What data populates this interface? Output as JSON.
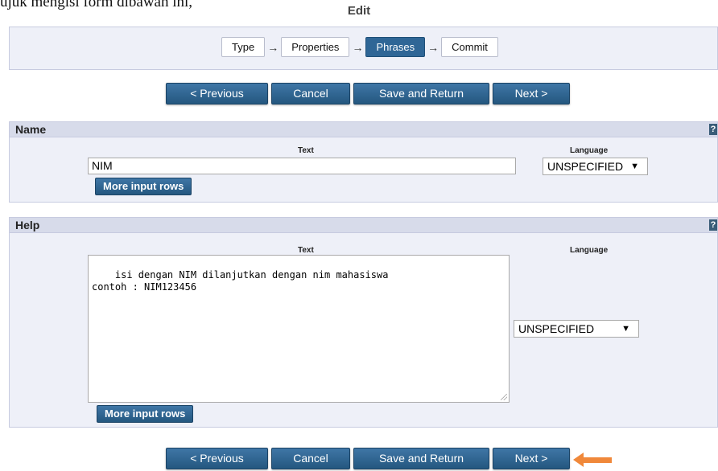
{
  "page": {
    "cut_off_text": "ujuk mengisi form dibawah ini,",
    "title": "Edit"
  },
  "wizard": {
    "steps": [
      {
        "label": "Type"
      },
      {
        "label": "Properties"
      },
      {
        "label": "Phrases",
        "active": true
      },
      {
        "label": "Commit"
      }
    ]
  },
  "nav": {
    "previous": "< Previous",
    "cancel": "Cancel",
    "save_return": "Save and Return",
    "next": "Next >"
  },
  "name_panel": {
    "title": "Name",
    "help_icon": "?",
    "text_col_label": "Text",
    "language_col_label": "Language",
    "text_value": "NIM",
    "language_value": "UNSPECIFIED",
    "more_rows": "More input rows"
  },
  "help_panel": {
    "title": "Help",
    "help_icon": "?",
    "text_col_label": "Text",
    "language_col_label": "Language",
    "text_value": "isi dengan NIM dilanjutkan dengan nim mahasiswa\ncontoh : NIM123456",
    "language_value": "UNSPECIFIED",
    "more_rows": "More input rows"
  },
  "colors": {
    "button_blue": "#2f6696",
    "panel_bg": "#eef0f8",
    "panel_header": "#d7dbea",
    "annotation_arrow": "#f0883a"
  },
  "icons": [
    "right-arrow-icon",
    "chevron-down-icon",
    "help-icon",
    "pointer-arrow-icon"
  ]
}
